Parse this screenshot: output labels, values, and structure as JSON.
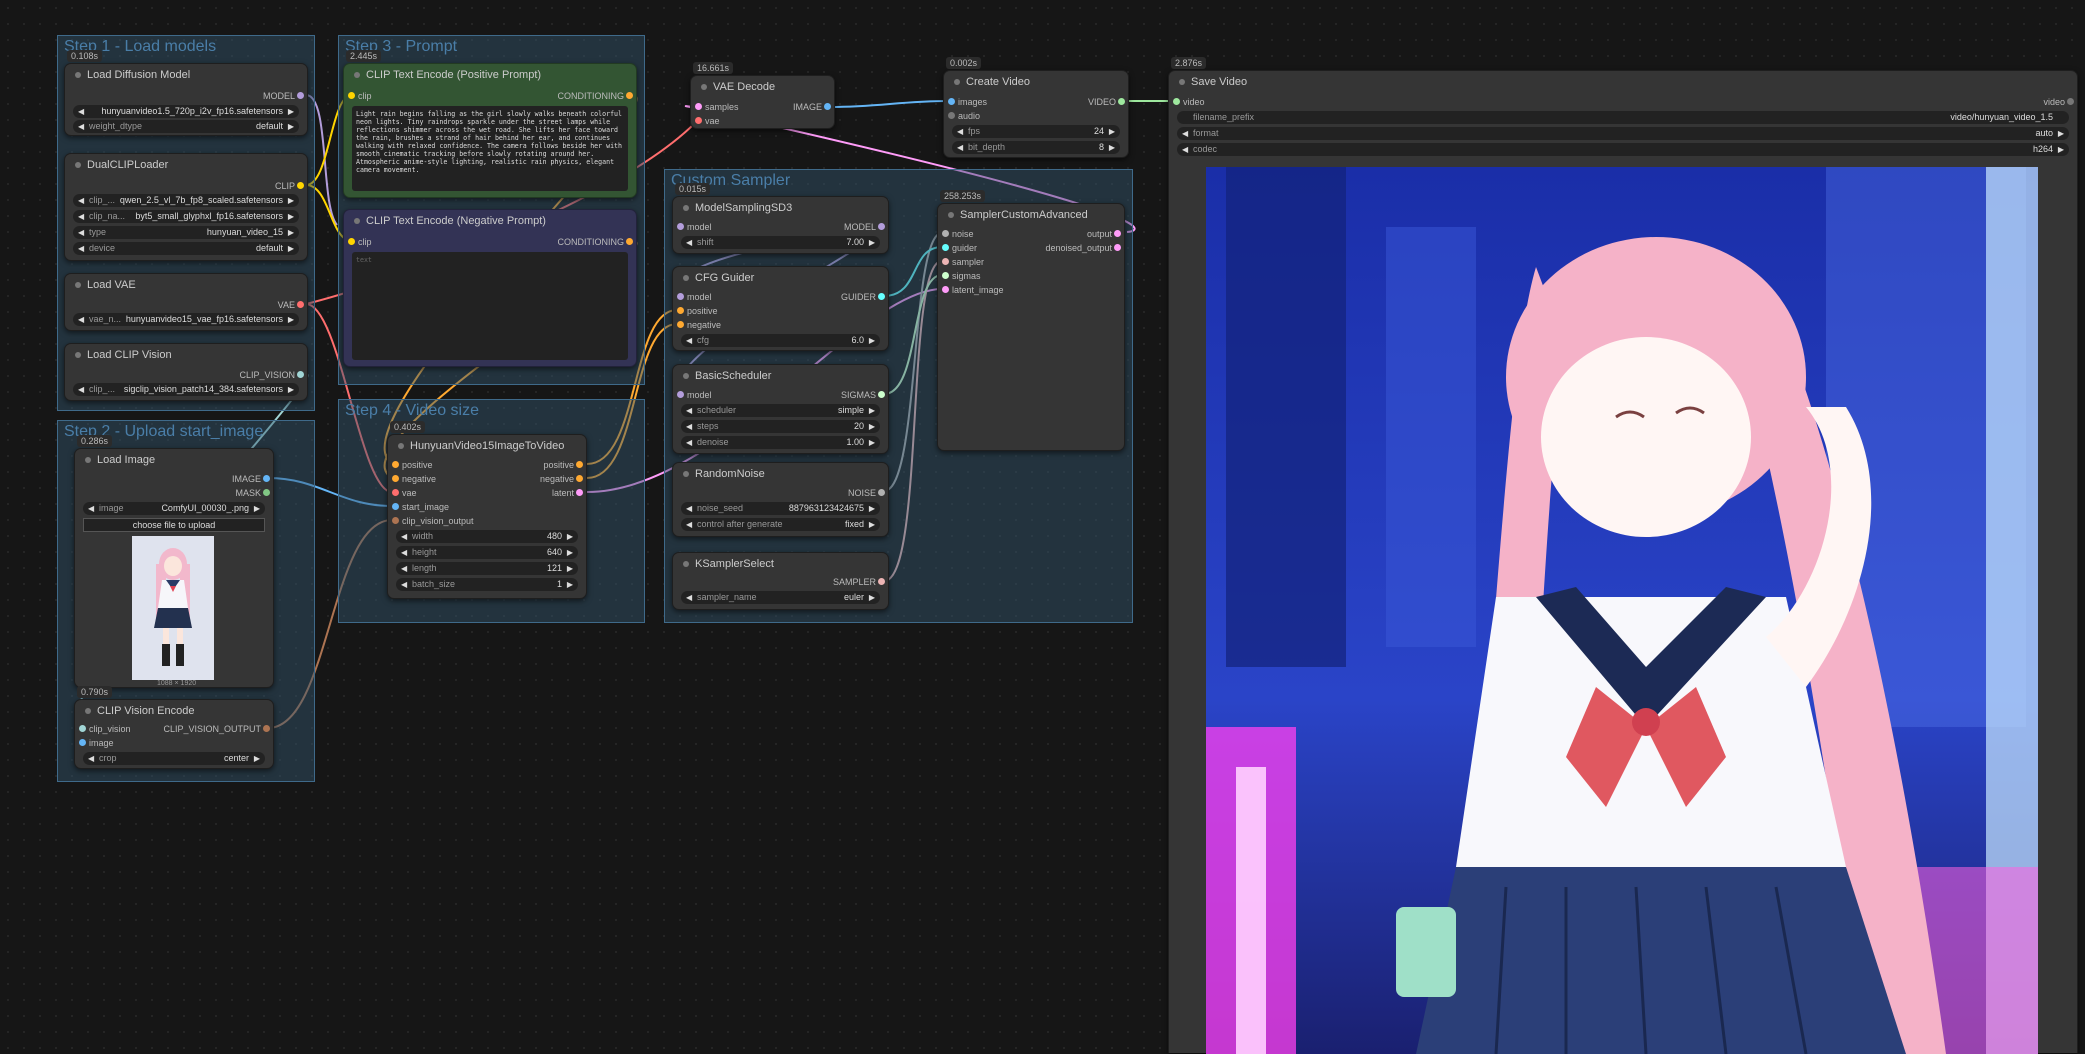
{
  "groups": {
    "step1": "Step 1 - Load models",
    "step2": "Step 2 - Upload start_image",
    "step3": "Step 3 - Prompt",
    "step4": "Step 4 - Video size",
    "sampler": "Custom Sampler"
  },
  "nodes": {
    "load_diffusion": {
      "time": "0.108s",
      "title": "Load Diffusion Model",
      "out": "MODEL",
      "w1_value": "hunyuanvideo1.5_720p_i2v_fp16.safetensors",
      "w2_label": "weight_dtype",
      "w2_value": "default"
    },
    "dualclip": {
      "title": "DualCLIPLoader",
      "out": "CLIP",
      "w1_label": "clip_...",
      "w1_value": "qwen_2.5_vl_7b_fp8_scaled.safetensors",
      "w2_label": "clip_na...",
      "w2_value": "byt5_small_glyphxl_fp16.safetensors",
      "w3_label": "type",
      "w3_value": "hunyuan_video_15",
      "w4_label": "device",
      "w4_value": "default"
    },
    "load_vae": {
      "title": "Load VAE",
      "out": "VAE",
      "w1_label": "vae_n...",
      "w1_value": "hunyuanvideo15_vae_fp16.safetensors"
    },
    "load_clip_vision": {
      "title": "Load CLIP Vision",
      "out": "CLIP_VISION",
      "w1_label": "clip_...",
      "w1_value": "sigclip_vision_patch14_384.safetensors"
    },
    "load_image": {
      "time": "0.286s",
      "title": "Load Image",
      "out1": "IMAGE",
      "out2": "MASK",
      "w1_label": "image",
      "w1_value": "ComfyUI_00030_.png",
      "upload": "choose file to upload",
      "size": "1088 × 1920"
    },
    "clip_vision_encode": {
      "time": "0.790s",
      "title": "CLIP Vision Encode",
      "in1": "clip_vision",
      "in2": "image",
      "out": "CLIP_VISION_OUTPUT",
      "w1_label": "crop",
      "w1_value": "center"
    },
    "clip_pos": {
      "time": "2.445s",
      "title": "CLIP Text Encode (Positive Prompt)",
      "in": "clip",
      "out": "CONDITIONING",
      "text": "Light rain begins falling as the girl slowly walks beneath colorful neon lights. Tiny raindrops sparkle under the street lamps while reflections shimmer across the wet road. She lifts her face toward the rain, brushes a strand of hair behind her ear, and continues walking with relaxed confidence. The camera follows beside her with smooth cinematic tracking before slowly rotating around her. Atmospheric anime-style lighting, realistic rain physics, elegant camera movement."
    },
    "clip_neg": {
      "title": "CLIP Text Encode (Negative Prompt)",
      "in": "clip",
      "out": "CONDITIONING",
      "placeholder": "text"
    },
    "hunyuan_i2v": {
      "time": "0.402s",
      "title": "HunyuanVideo15ImageToVideo",
      "in1": "positive",
      "in2": "negative",
      "in3": "vae",
      "in4": "start_image",
      "in5": "clip_vision_output",
      "out1": "positive",
      "out2": "negative",
      "out3": "latent",
      "w1_label": "width",
      "w1_value": "480",
      "w2_label": "height",
      "w2_value": "640",
      "w3_label": "length",
      "w3_value": "121",
      "w4_label": "batch_size",
      "w4_value": "1"
    },
    "vae_decode": {
      "time": "16.661s",
      "title": "VAE Decode",
      "in1": "samples",
      "in2": "vae",
      "out": "IMAGE"
    },
    "create_video": {
      "time": "0.002s",
      "title": "Create Video",
      "in1": "images",
      "in2": "audio",
      "out": "VIDEO",
      "w1_label": "fps",
      "w1_value": "24",
      "w2_label": "bit_depth",
      "w2_value": "8"
    },
    "save_video": {
      "time": "2.876s",
      "title": "Save Video",
      "in": "video",
      "out": "video",
      "w1_label": "filename_prefix",
      "w1_value": "video/hunyuan_video_1.5",
      "w2_label": "format",
      "w2_value": "auto",
      "w3_label": "codec",
      "w3_value": "h264"
    },
    "model_sampling": {
      "time": "0.015s",
      "title": "ModelSamplingSD3",
      "in": "model",
      "out": "MODEL",
      "w1_label": "shift",
      "w1_value": "7.00"
    },
    "cfg_guider": {
      "title": "CFG Guider",
      "in1": "model",
      "in2": "positive",
      "in3": "negative",
      "out": "GUIDER",
      "w1_label": "cfg",
      "w1_value": "6.0"
    },
    "basic_scheduler": {
      "title": "BasicScheduler",
      "in": "model",
      "out": "SIGMAS",
      "w1_label": "scheduler",
      "w1_value": "simple",
      "w2_label": "steps",
      "w2_value": "20",
      "w3_label": "denoise",
      "w3_value": "1.00"
    },
    "random_noise": {
      "title": "RandomNoise",
      "out": "NOISE",
      "w1_label": "noise_seed",
      "w1_value": "887963123424675",
      "w2_label": "control after generate",
      "w2_value": "fixed"
    },
    "ksampler_select": {
      "title": "KSamplerSelect",
      "out": "SAMPLER",
      "w1_label": "sampler_name",
      "w1_value": "euler"
    },
    "sampler_custom": {
      "time": "258.253s",
      "title": "SamplerCustomAdvanced",
      "in1": "noise",
      "in2": "guider",
      "in3": "sampler",
      "in4": "sigmas",
      "in5": "latent_image",
      "out1": "output",
      "out2": "denoised_output"
    }
  },
  "colors": {
    "model": "#b39ddb",
    "clip": "#ffd500",
    "vae": "#ff6e6e",
    "image": "#64b5f6",
    "cond": "#ffa931",
    "latent": "#ff9cf9",
    "clipvision": "#a1d5d5",
    "clipvisionout": "#ad7452",
    "video": "#9ee89e",
    "noise": "#b0b0b0",
    "guider": "#66ffff",
    "sampler": "#ecb4b4",
    "sigmas": "#cdffcd",
    "mask": "#81c784",
    "pos_bg": "#335533",
    "neg_bg": "#333355"
  }
}
